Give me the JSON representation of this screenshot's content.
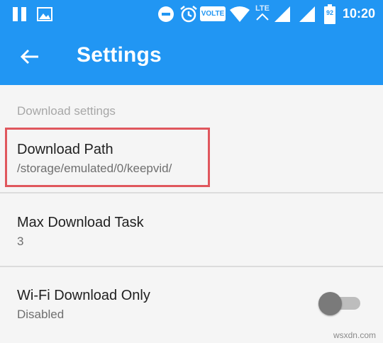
{
  "status_bar": {
    "time": "10:20",
    "network": "VOLTE",
    "lte": "LTE",
    "battery": "92",
    "icons": [
      "pause-icon",
      "image-icon",
      "do-not-disturb-icon",
      "alarm-icon",
      "volte-icon",
      "wifi-icon",
      "lte-icon",
      "signal-icon",
      "signal-icon",
      "battery-icon"
    ]
  },
  "app_bar": {
    "title": "Settings",
    "back_icon": "arrow-back-icon"
  },
  "section_header": "Download settings",
  "items": [
    {
      "title": "Download Path",
      "subtitle": "/storage/emulated/0/keepvid/"
    },
    {
      "title": "Max Download Task",
      "subtitle": "3"
    },
    {
      "title": "Wi-Fi Download Only",
      "subtitle": "Disabled",
      "toggle_on": false
    }
  ],
  "colors": {
    "primary": "#2196f3",
    "highlight_border": "#e0575d"
  },
  "watermark": "wsxdn.com"
}
